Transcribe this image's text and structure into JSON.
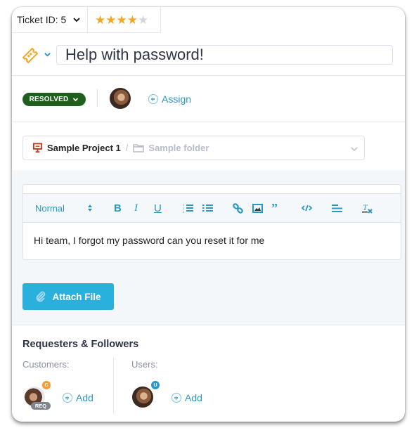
{
  "header": {
    "ticket_id_label": "Ticket ID: 5",
    "rating": {
      "value": 4,
      "max": 5,
      "filled_color": "#f5a623",
      "empty_color": "#d3d6dc"
    }
  },
  "ticket": {
    "type_icon": "ticket-icon",
    "title": "Help with password!"
  },
  "status": {
    "label": "RESOLVED",
    "color": "#1e5f1e",
    "assign_label": "Assign"
  },
  "project": {
    "project_name": "Sample Project 1",
    "separator": "/",
    "folder_placeholder": "Sample folder"
  },
  "editor": {
    "format_label": "Normal",
    "tools": [
      "bold",
      "italic",
      "underline",
      "ordered-list",
      "bullet-list",
      "link",
      "image",
      "blockquote",
      "code",
      "align",
      "clear-format"
    ],
    "content": "Hi team, I forgot my password can you reset it for me"
  },
  "attach": {
    "label": "Attach File"
  },
  "requesters": {
    "title": "Requesters & Followers",
    "customers_label": "Customers:",
    "users_label": "Users:",
    "customer_badge": "C",
    "customer_tag": "REQ",
    "user_badge": "U",
    "add_label": "Add"
  },
  "colors": {
    "accent": "#2a98c7",
    "button": "#2ab0dc",
    "ticket_icon": "#f5a623",
    "project_icon": "#c0391b"
  }
}
